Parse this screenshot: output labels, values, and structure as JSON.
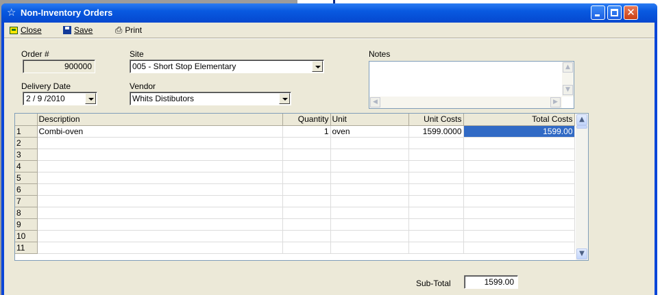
{
  "window": {
    "title": "Non-Inventory Orders"
  },
  "toolbar": {
    "close_label": "Close",
    "save_label": "Save",
    "print_label": "Print"
  },
  "form": {
    "order_label": "Order #",
    "order_value": "900000",
    "site_label": "Site",
    "site_value": "005 - Short Stop Elementary",
    "notes_label": "Notes",
    "notes_value": "",
    "delivery_label": "Delivery Date",
    "delivery_value": "2 / 9 /2010",
    "vendor_label": "Vendor",
    "vendor_value": "Whits Distibutors"
  },
  "grid": {
    "columns": [
      "",
      "Description",
      "Quantity",
      "Unit",
      "Unit Costs",
      "Total Costs"
    ],
    "rows": [
      {
        "num": "1",
        "description": "Combi-oven",
        "quantity": "1",
        "unit": "oven",
        "unit_cost": "1599.0000",
        "total_cost": "1599.00"
      },
      {
        "num": "2",
        "description": "",
        "quantity": "",
        "unit": "",
        "unit_cost": "",
        "total_cost": ""
      },
      {
        "num": "3",
        "description": "",
        "quantity": "",
        "unit": "",
        "unit_cost": "",
        "total_cost": ""
      },
      {
        "num": "4",
        "description": "",
        "quantity": "",
        "unit": "",
        "unit_cost": "",
        "total_cost": ""
      },
      {
        "num": "5",
        "description": "",
        "quantity": "",
        "unit": "",
        "unit_cost": "",
        "total_cost": ""
      },
      {
        "num": "6",
        "description": "",
        "quantity": "",
        "unit": "",
        "unit_cost": "",
        "total_cost": ""
      },
      {
        "num": "7",
        "description": "",
        "quantity": "",
        "unit": "",
        "unit_cost": "",
        "total_cost": ""
      },
      {
        "num": "8",
        "description": "",
        "quantity": "",
        "unit": "",
        "unit_cost": "",
        "total_cost": ""
      },
      {
        "num": "9",
        "description": "",
        "quantity": "",
        "unit": "",
        "unit_cost": "",
        "total_cost": ""
      },
      {
        "num": "10",
        "description": "",
        "quantity": "",
        "unit": "",
        "unit_cost": "",
        "total_cost": ""
      },
      {
        "num": "11",
        "description": "",
        "quantity": "",
        "unit": "",
        "unit_cost": "",
        "total_cost": ""
      }
    ]
  },
  "footer": {
    "subtotal_label": "Sub-Total",
    "subtotal_value": "1599.00"
  },
  "colors": {
    "titlebar": "#0859e0",
    "client": "#ece9d8",
    "selection": "#316ac5",
    "close_button": "#c93f14"
  }
}
